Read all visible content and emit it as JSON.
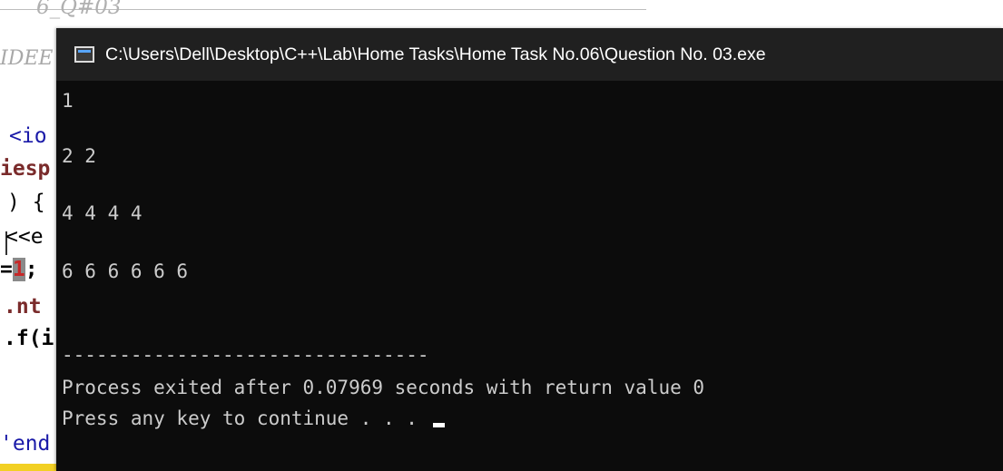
{
  "editor": {
    "header_fragment": "6_Q#03",
    "comment_fragment": "IDEE",
    "lines": {
      "include": "<io",
      "namespace": "iesp",
      "main": ") {",
      "cout": "<<e",
      "assign_prefix": "=",
      "assign_value": "1",
      "assign_suffix": ";",
      "int_decl": ".nt",
      "if_stmt": ".f(i",
      "endl": "'end"
    }
  },
  "console": {
    "title": "C:\\Users\\Dell\\Desktop\\C++\\Lab\\Home Tasks\\Home Task No.06\\Question No. 03.exe",
    "output": {
      "line1": "1",
      "line2": "2 2",
      "line3": "4 4 4 4",
      "line4": "6 6 6 6 6 6",
      "separator": "--------------------------------",
      "exit_message": "Process exited after 0.07969 seconds with return value 0",
      "prompt": "Press any key to continue . . . "
    },
    "colors": {
      "background": "#0c0c0c",
      "titlebar": "#202020",
      "text": "#cccccc"
    }
  }
}
